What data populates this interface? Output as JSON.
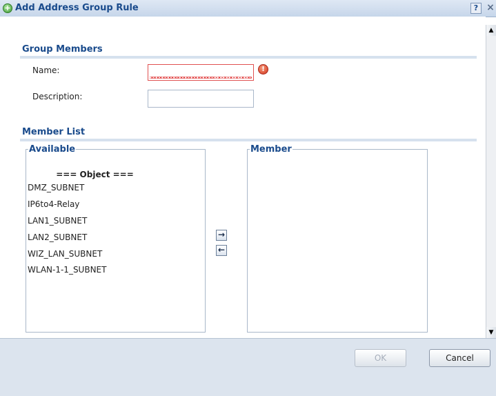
{
  "dialog": {
    "title": "Add Address Group Rule",
    "help_label": "?",
    "close_label": "×"
  },
  "group_members": {
    "section_title": "Group Members",
    "name_label": "Name:",
    "name_value": "",
    "name_error_icon": "!",
    "description_label": "Description:",
    "description_value": ""
  },
  "member_list": {
    "section_title": "Member List",
    "available": {
      "legend": "Available",
      "heading": "=== Object ===",
      "items": [
        "DMZ_SUBNET",
        "IP6to4-Relay",
        "LAN1_SUBNET",
        "LAN2_SUBNET",
        "WIZ_LAN_SUBNET",
        "WLAN-1-1_SUBNET"
      ]
    },
    "member": {
      "legend": "Member",
      "items": []
    },
    "add_arrow": "→",
    "remove_arrow": "←"
  },
  "footer": {
    "ok_label": "OK",
    "cancel_label": "Cancel"
  }
}
